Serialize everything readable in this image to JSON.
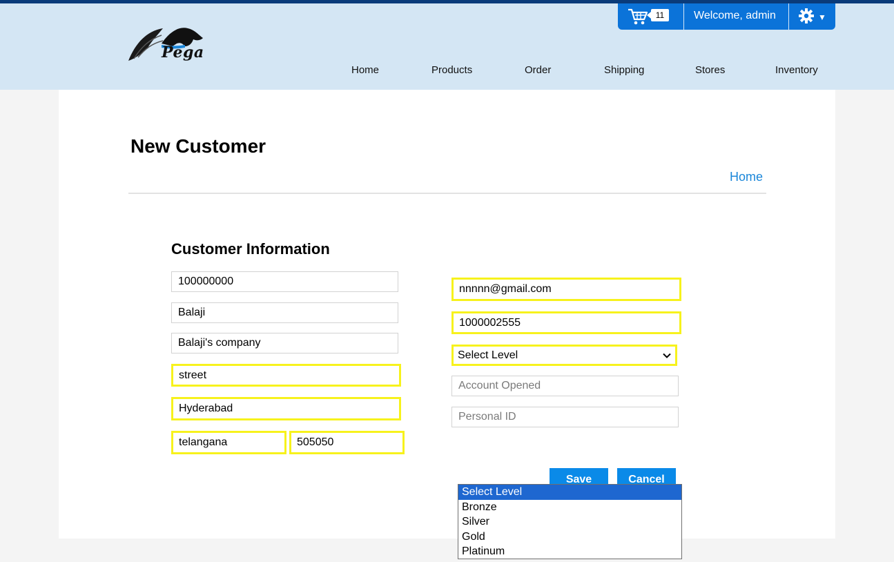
{
  "brand": {
    "logo_text": "Pega"
  },
  "userbar": {
    "cart_count": "11",
    "welcome": "Welcome, admin",
    "icons": [
      "cart-icon",
      "gear-icon",
      "caret-down-icon"
    ]
  },
  "nav": [
    "Home",
    "Products",
    "Order",
    "Shipping",
    "Stores",
    "Inventory"
  ],
  "page": {
    "title": "New Customer",
    "breadcrumb_home": "Home"
  },
  "form": {
    "section_title": "Customer Information",
    "left": {
      "id_value": "100000000",
      "name_value": "Balaji",
      "company_value": "Balaji's company",
      "street_value": "street",
      "city_value": "Hyderabad",
      "state_value": "telangana",
      "zip_value": "505050"
    },
    "right": {
      "email_value": "nnnnn@gmail.com",
      "phone_value": "1000002555",
      "level_selected": "Select Level",
      "account_opened_placeholder": "Account Opened",
      "personal_id_placeholder": "Personal ID"
    },
    "level_options": [
      "Select Level",
      "Bronze",
      "Silver",
      "Gold",
      "Platinum"
    ],
    "save_label": "Save",
    "cancel_label": "Cancel"
  },
  "colors": {
    "accent": "#0a8ae8",
    "highlight": "#f7f21c",
    "header_bg": "#d4e6f4",
    "userbar_bg": "#0b73d9",
    "link": "#1a86d9",
    "option_selected": "#1e67d0"
  }
}
